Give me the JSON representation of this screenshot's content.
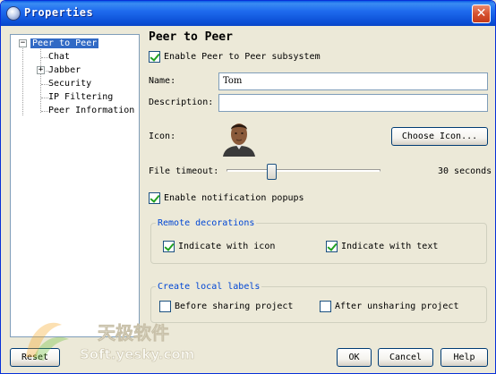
{
  "window": {
    "title": "Properties",
    "close_glyph": "✕"
  },
  "tree": {
    "items": [
      {
        "label": "Peer to Peer",
        "selected": true,
        "expander": "−"
      },
      {
        "label": "Chat"
      },
      {
        "label": "Jabber",
        "expander": "+"
      },
      {
        "label": "Security"
      },
      {
        "label": "IP Filtering"
      },
      {
        "label": "Peer Information"
      }
    ]
  },
  "panel": {
    "title": "Peer to Peer",
    "enable_p2p": {
      "label": "Enable Peer to Peer subsystem",
      "checked": true
    },
    "name": {
      "label": "Name:",
      "value": "Tom"
    },
    "description": {
      "label": "Description:",
      "value": ""
    },
    "icon": {
      "label": "Icon:",
      "button": "Choose Icon..."
    },
    "file_timeout": {
      "label": "File timeout:",
      "value": "30 seconds",
      "level": 0.28
    },
    "notification_popups": {
      "label": "Enable notification popups",
      "checked": true
    },
    "remote_decorations": {
      "title": "Remote decorations",
      "with_icon": {
        "label": "Indicate with icon",
        "checked": true
      },
      "with_text": {
        "label": "Indicate with text",
        "checked": true
      }
    },
    "local_labels": {
      "title": "Create local labels",
      "before": {
        "label": "Before sharing project",
        "checked": false
      },
      "after": {
        "label": "After unsharing project",
        "checked": false
      }
    }
  },
  "footer": {
    "reset": "Reset",
    "ok": "OK",
    "cancel": "Cancel",
    "help": "Help"
  },
  "watermark": {
    "cn": "天极软件",
    "site": "Soft.yesky.com"
  },
  "colors": {
    "titlebar": "#0b4fd6",
    "selection": "#316ac5",
    "group_title": "#0046d5",
    "checkmark": "#21a121"
  }
}
